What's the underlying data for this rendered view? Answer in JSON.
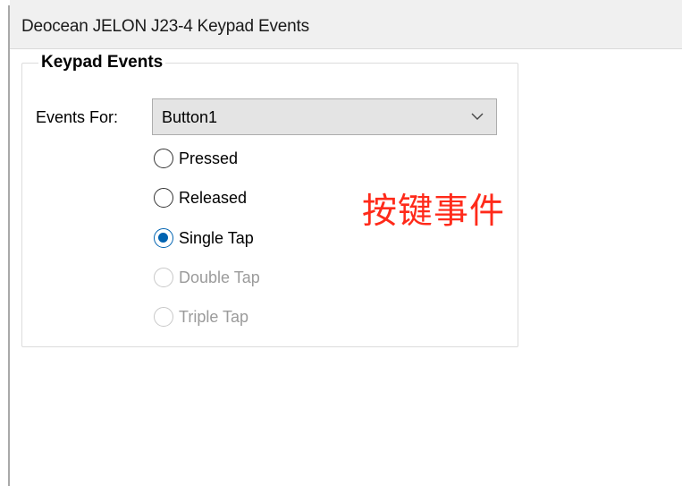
{
  "window": {
    "title": "Deocean JELON J23-4 Keypad Events"
  },
  "group": {
    "legend": "Keypad Events"
  },
  "events_for": {
    "label": "Events For:",
    "selected": "Button1"
  },
  "radios": [
    {
      "label": "Pressed",
      "checked": false,
      "enabled": true
    },
    {
      "label": "Released",
      "checked": false,
      "enabled": true
    },
    {
      "label": "Single Tap",
      "checked": true,
      "enabled": true
    },
    {
      "label": "Double Tap",
      "checked": false,
      "enabled": false
    },
    {
      "label": "Triple Tap",
      "checked": false,
      "enabled": false
    }
  ],
  "annotation": {
    "text": "按键事件",
    "color": "#ff2a1a"
  },
  "colors": {
    "accent": "#0063b1",
    "disabled_text": "#9b9b9b"
  }
}
